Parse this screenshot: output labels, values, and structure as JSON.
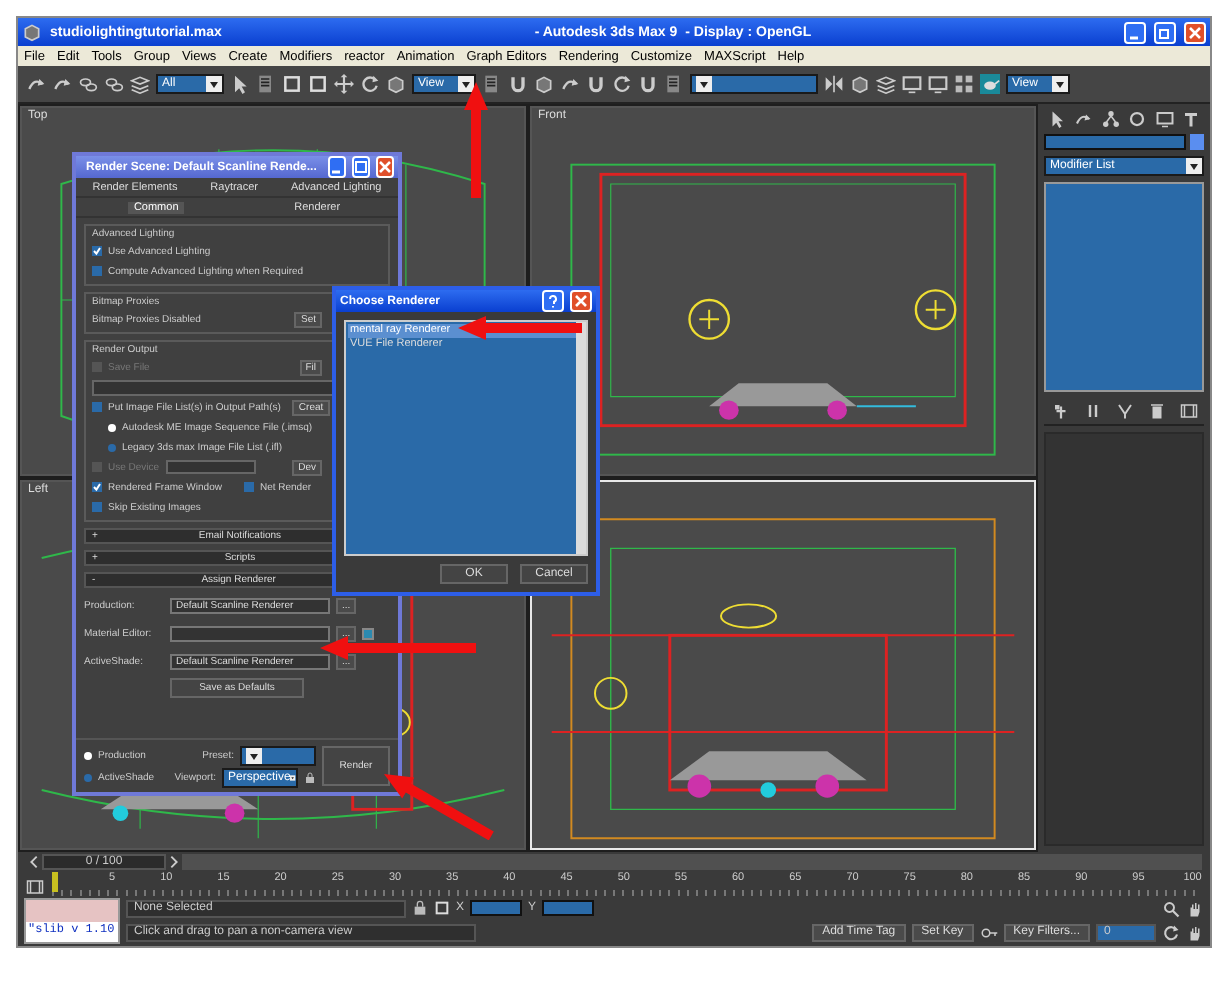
{
  "window": {
    "title": "studiolightingtutorial.max",
    "app": "- Autodesk 3ds Max 9",
    "display": "- Display : OpenGL"
  },
  "menu": [
    "File",
    "Edit",
    "Tools",
    "Group",
    "Views",
    "Create",
    "Modifiers",
    "reactor",
    "Animation",
    "Graph Editors",
    "Rendering",
    "Customize",
    "MAXScript",
    "Help"
  ],
  "toolbar": {
    "dropdowns": [
      {
        "value": "All"
      },
      {
        "value": "View"
      },
      {
        "kind": "named-selection"
      },
      {
        "value": "View"
      }
    ]
  },
  "viewports": [
    {
      "label": "Top",
      "kind": "top",
      "active": false
    },
    {
      "label": "Front",
      "kind": "front",
      "active": false
    },
    {
      "label": "Left",
      "kind": "left",
      "active": false
    },
    {
      "kind": "perspective",
      "active": true
    }
  ],
  "command_panel": {
    "modifier_list": "Modifier List"
  },
  "render_dialog": {
    "title": "Render Scene: Default Scanline Rende...",
    "tab_rows": [
      [
        {
          "label": "Render Elements",
          "selected": false
        },
        {
          "label": "Raytracer",
          "selected": false
        },
        {
          "label": "Advanced Lighting",
          "selected": false
        }
      ],
      [
        {
          "label": "Common",
          "selected": true
        },
        {
          "label": "Renderer",
          "selected": false
        }
      ]
    ],
    "advanced_lighting": {
      "title": "Advanced Lighting",
      "options": [
        {
          "label": "Use Advanced Lighting",
          "checked": true
        },
        {
          "label": "Compute Advanced Lighting when Required",
          "checked": false
        }
      ]
    },
    "bitmap_proxies": {
      "title": "Bitmap Proxies",
      "status": "Bitmap Proxies Disabled",
      "button": "Set"
    },
    "render_output": {
      "title": "Render Output",
      "save_file": {
        "label": "Save File",
        "checked": false,
        "disabled": true
      },
      "files_button": "Fil",
      "put_list": {
        "label": "Put Image File List(s) in Output Path(s)",
        "checked": false
      },
      "create_button": "Creat",
      "formats": [
        {
          "label": "Autodesk ME Image Sequence File (.imsq)",
          "selected": true
        },
        {
          "label": "Legacy 3ds max Image File List (.ifl)",
          "selected": false
        }
      ],
      "use_device": {
        "label": "Use Device",
        "checked": false,
        "disabled": true
      },
      "devices_button": "Dev",
      "options": [
        {
          "label": "Rendered Frame Window",
          "checked": true
        },
        {
          "label": "Net Render",
          "checked": false
        }
      ],
      "skip": {
        "label": "Skip Existing Images",
        "checked": false
      }
    },
    "rollouts": [
      {
        "toggle": "+",
        "label": "Email Notifications"
      },
      {
        "toggle": "+",
        "label": "Scripts"
      },
      {
        "toggle": "-",
        "label": "Assign Renderer"
      }
    ],
    "assign_renderer": [
      {
        "kind": "plain",
        "label": "Production:",
        "value": "Default Scanline Renderer",
        "button": "..."
      },
      {
        "kind": "lockable",
        "label": "Material Editor:",
        "button": "..."
      },
      {
        "kind": "plain",
        "label": "ActiveShade:",
        "value": "Default Scanline Renderer",
        "button": "..."
      }
    ],
    "save_defaults": "Save as Defaults",
    "modes": [
      {
        "label": "Production",
        "selected": true
      },
      {
        "label": "ActiveShade",
        "selected": false
      }
    ],
    "preset_label": "Preset:",
    "viewport_label": "Viewport:",
    "viewport_value": "Perspective",
    "render_button": "Render"
  },
  "choose_renderer": {
    "title": "Choose Renderer",
    "items": [
      {
        "label": "mental ray Renderer",
        "selected": true
      },
      {
        "label": "VUE File Renderer",
        "selected": false
      }
    ],
    "buttons": [
      "OK",
      "Cancel"
    ]
  },
  "time_slider": {
    "frame": "0 / 100",
    "level": 0,
    "ticks": [
      "5",
      "10",
      "15",
      "20",
      "25",
      "30",
      "35",
      "40",
      "45",
      "50",
      "55",
      "60",
      "65",
      "70",
      "75",
      "80",
      "85",
      "90",
      "95",
      "100"
    ]
  },
  "status_bar": {
    "listener": "\"slib v 1.10",
    "selection": "None Selected",
    "x_label": "X",
    "y_label": "Y",
    "prompt": "Click and drag to pan a non-camera view",
    "add_time_tag": "Add Time Tag",
    "set_key": "Set Key",
    "key_filters": "Key Filters...",
    "frame": "0"
  },
  "callout_arrows": [
    {
      "kind": "up"
    },
    {
      "kind": "left"
    },
    {
      "kind": "left"
    },
    {
      "kind": "up-left"
    }
  ]
}
